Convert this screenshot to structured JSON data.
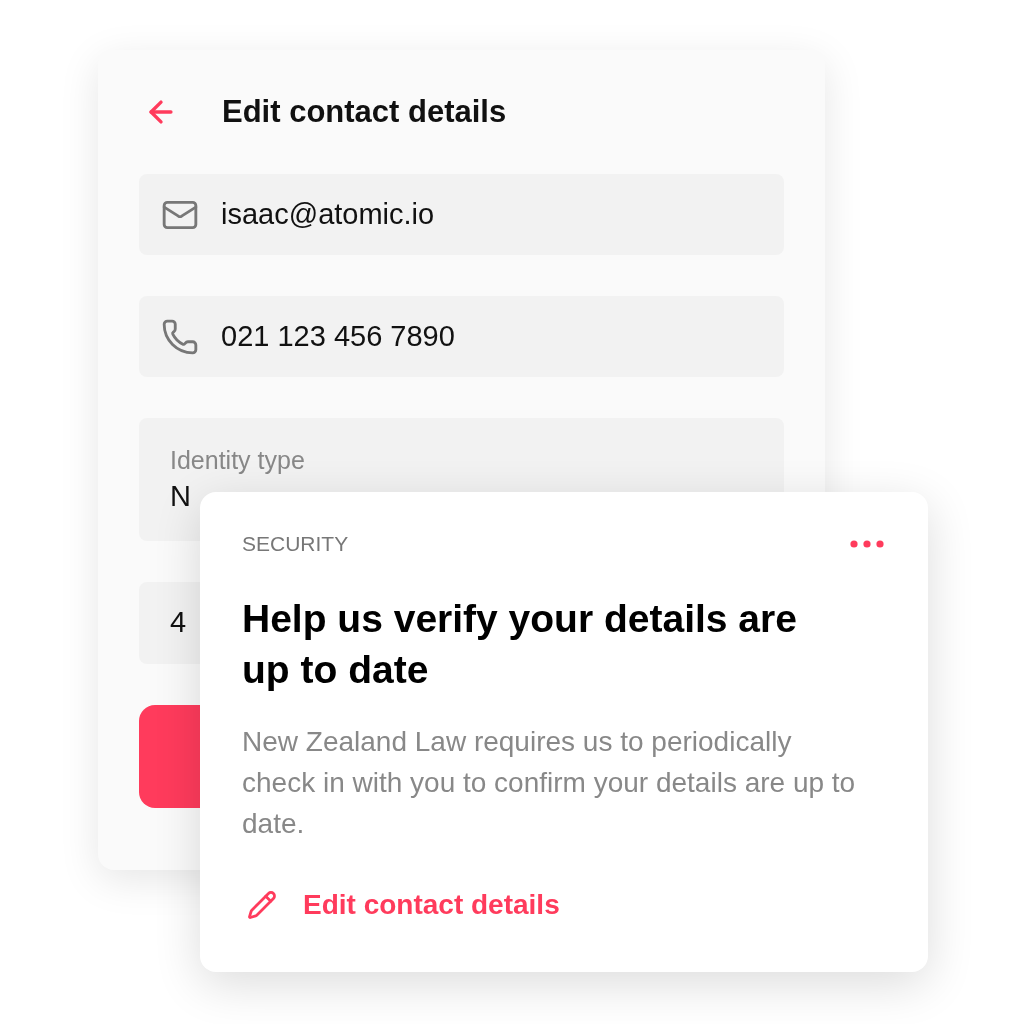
{
  "edit_card": {
    "title": "Edit contact details",
    "fields": [
      {
        "kind": "email",
        "value": "isaac@atomic.io"
      },
      {
        "kind": "phone",
        "value": "021 123 456 7890"
      },
      {
        "kind": "labeled",
        "label": "Identity type",
        "value": "N"
      },
      {
        "kind": "plain",
        "value": "4"
      }
    ]
  },
  "notice_card": {
    "category": "SECURITY",
    "heading": "Help us verify your details are up to date",
    "body": "New Zealand Law requires us to periodically check in with you to confirm your details are up to date.",
    "link": "Edit contact details"
  }
}
